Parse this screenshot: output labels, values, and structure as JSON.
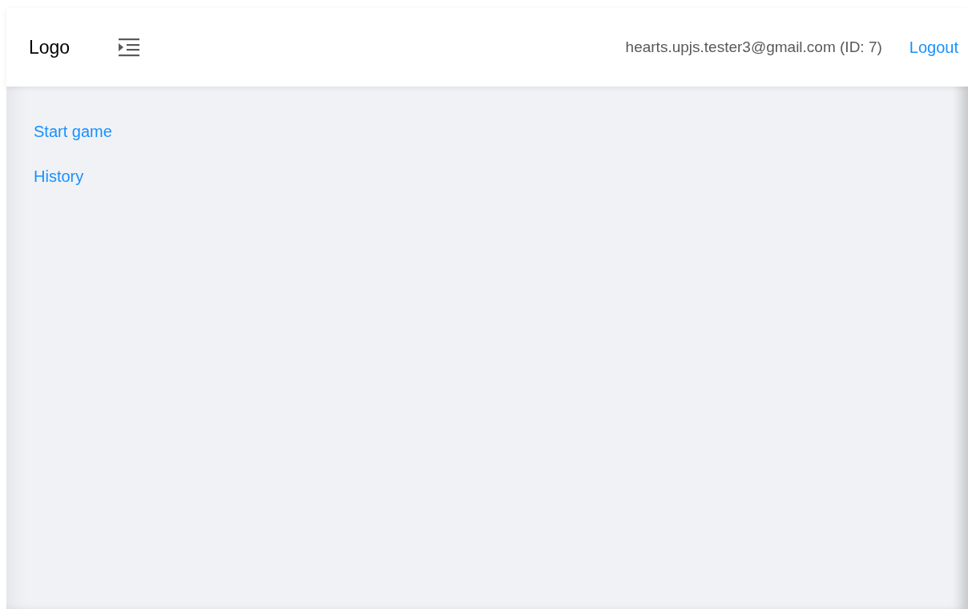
{
  "header": {
    "logo": "Logo",
    "user": "hearts.upjs.tester3@gmail.com (ID: 7)",
    "logout": "Logout"
  },
  "nav": [
    {
      "label": "Start game"
    },
    {
      "label": "History"
    }
  ]
}
